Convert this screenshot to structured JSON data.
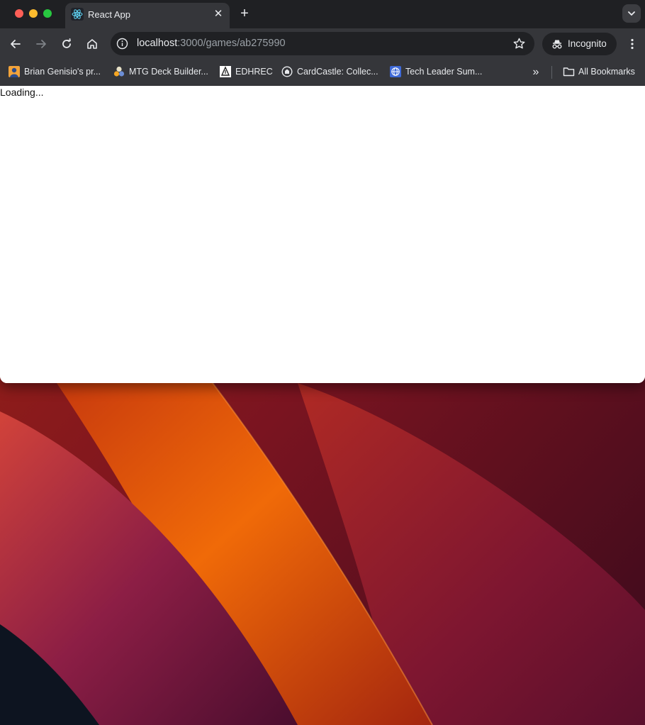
{
  "tab": {
    "title": "React App",
    "close_icon": "close-icon",
    "new_tab": "+"
  },
  "toolbar": {
    "url_host": "localhost",
    "url_path": ":3000/games/ab275990",
    "incognito_label": "Incognito"
  },
  "bookmarks": {
    "items": [
      {
        "label": "Brian Genisio's pr...",
        "icon": "profile-icon"
      },
      {
        "label": "MTG Deck Builder...",
        "icon": "mtg-icon"
      },
      {
        "label": "EDHREC",
        "icon": "edhrec-icon"
      },
      {
        "label": "CardCastle: Collec...",
        "icon": "cardcastle-icon"
      },
      {
        "label": "Tech Leader Sum...",
        "icon": "globe-icon"
      }
    ],
    "overflow": "»",
    "all_bookmarks_label": "All Bookmarks"
  },
  "page": {
    "loading_text": "Loading..."
  },
  "colors": {
    "titlebar": "#1f2023",
    "toolbar": "#35363a",
    "omnibox": "#202124",
    "close": "#fe5f57",
    "minimize": "#febc2e",
    "zoom": "#28c840"
  }
}
